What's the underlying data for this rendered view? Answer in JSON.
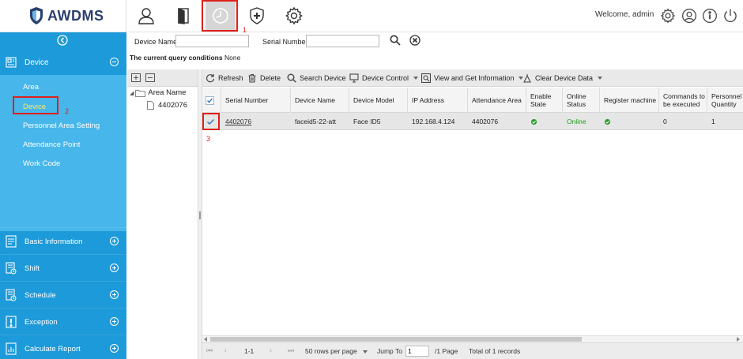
{
  "brand": {
    "name": "AWDMS"
  },
  "header": {
    "welcome": "Welcome, admin",
    "nav_icons": [
      "personnel-icon",
      "door-icon",
      "attendance-clock-icon",
      "shield-plus-icon",
      "settings-gear-icon"
    ],
    "right_icons": [
      "gear-icon",
      "user-circle-icon",
      "info-icon",
      "power-icon"
    ]
  },
  "annotations": {
    "n1": "1",
    "n2": "2",
    "n3": "3",
    "color": "#e0201a"
  },
  "sidebar": {
    "section_open": "Device",
    "sub_items": [
      "Area",
      "Device",
      "Personnel Area Setting",
      "Attendance Point",
      "Work Code"
    ],
    "selected_sub": "Device",
    "sections": [
      "Basic Information",
      "Shift",
      "Schedule",
      "Exception",
      "Calculate Report"
    ]
  },
  "query": {
    "device_name_label": "Device Name",
    "device_name_value": "",
    "serial_number_label": "Serial Number",
    "serial_number_value": "",
    "conditions_label": "The current query conditions",
    "conditions_value": "None"
  },
  "tree": {
    "root": "Area Name",
    "child": "4402076"
  },
  "toolbar": {
    "refresh": "Refresh",
    "delete": "Delete",
    "search_device": "Search Device",
    "device_control": "Device Control",
    "view_get_info": "View and Get Information",
    "clear_device_data": "Clear Device Data"
  },
  "table": {
    "columns": [
      "Serial Number",
      "Device Name",
      "Device Model",
      "IP Address",
      "Attendance Area",
      "Enable State",
      "Online Status",
      "Register machine",
      "Commands to be executed",
      "Personnel Quantity"
    ],
    "rows": [
      {
        "serial_number": "4402076",
        "device_name": "faceid5-22-att",
        "device_model": "Face ID5",
        "ip_address": "192.168.4.124",
        "attendance_area": "4402076",
        "enable_state": "enabled",
        "online_status": "Online",
        "register_machine": "enabled",
        "commands": "0",
        "personnel_quantity": "1",
        "checked": true
      }
    ]
  },
  "pager": {
    "range": "1-1",
    "rows_per_page": "50 rows per page",
    "jump_to_label": "Jump To",
    "jump_to_value": "1",
    "pages": "/1 Page",
    "total": "Total of 1 records"
  },
  "colors": {
    "sidebar": "#1d9ad9",
    "submenu": "#47b6ea",
    "selected_sub_text": "#ffe86b",
    "online": "#1e9e1e",
    "brand_text": "#2a3f6e"
  }
}
